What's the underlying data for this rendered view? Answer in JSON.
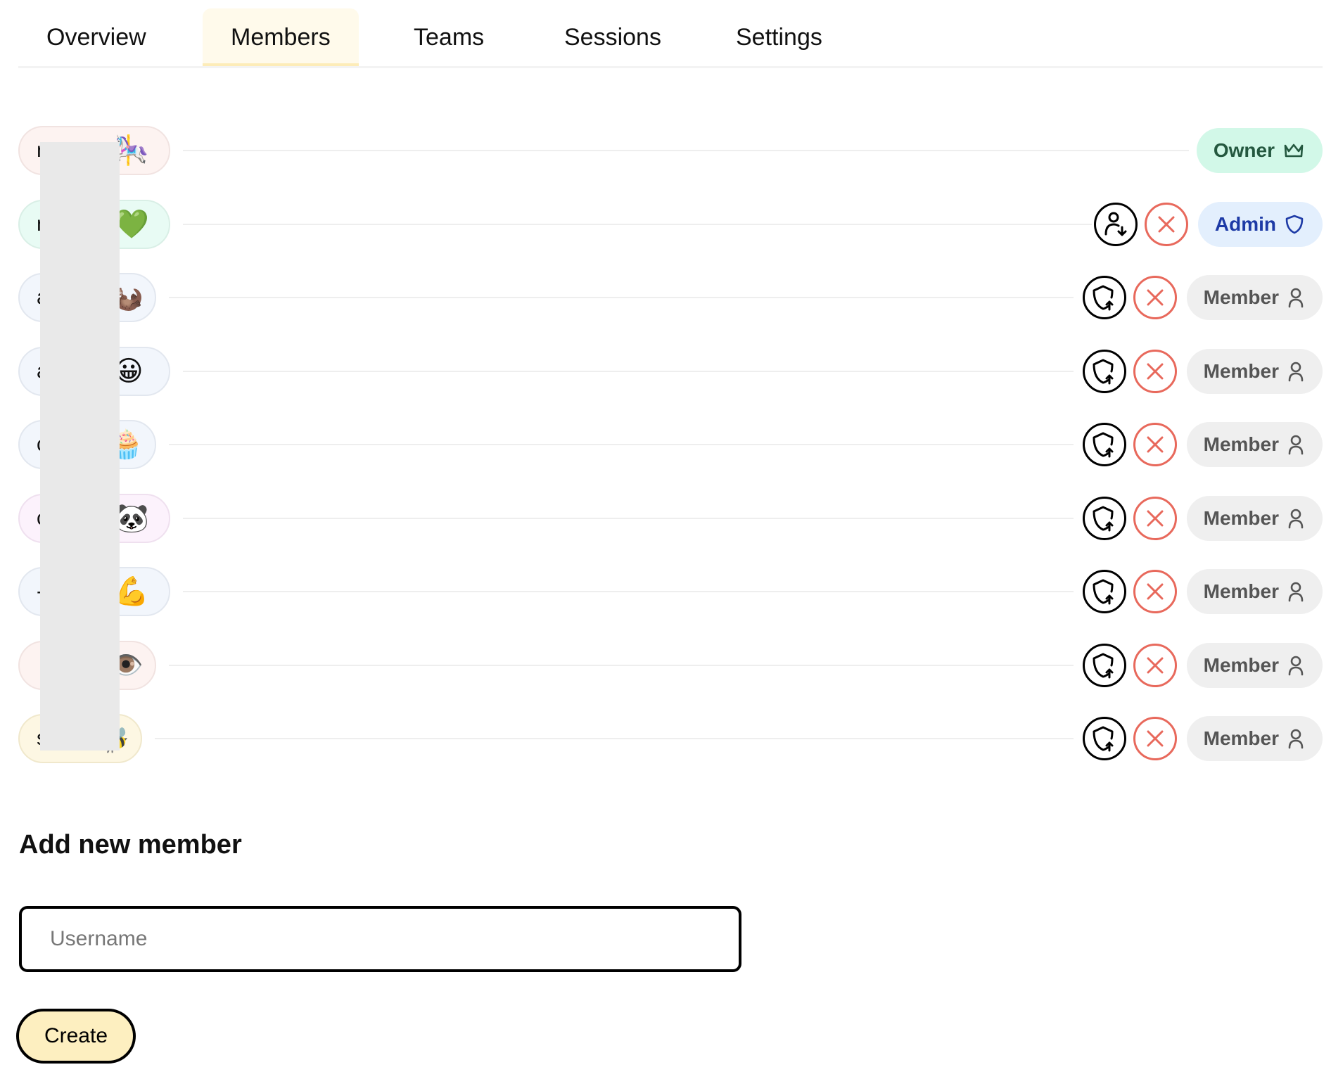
{
  "tabs": [
    {
      "label": "Overview",
      "active": false
    },
    {
      "label": "Members",
      "active": true
    },
    {
      "label": "Teams",
      "active": false
    },
    {
      "label": "Sessions",
      "active": false
    },
    {
      "label": "Settings",
      "active": false
    }
  ],
  "members": [
    {
      "name_initial": "n",
      "emoji": "🎠",
      "emoji_name": "carousel-horse-icon",
      "role": "Owner",
      "role_icon": "crown-icon",
      "pill_bg": "#fdf3f1",
      "pill_border": "#f1e3e1",
      "actions": []
    },
    {
      "name_initial": "n",
      "emoji": "💚",
      "emoji_name": "green-heart-icon",
      "role": "Admin",
      "role_icon": "shield-icon",
      "pill_bg": "#e8fbf4",
      "pill_border": "#d9efe6",
      "actions": [
        "demote",
        "remove"
      ]
    },
    {
      "name_initial": "a",
      "emoji": "🦦",
      "emoji_name": "otter-icon",
      "role": "Member",
      "role_icon": "user-icon",
      "pill_bg": "#f2f6fc",
      "pill_border": "#e2e7ef",
      "actions": [
        "promote",
        "remove"
      ]
    },
    {
      "name_initial": "a",
      "emoji": "😀",
      "emoji_name": "grinning-face-icon",
      "role": "Member",
      "role_icon": "user-icon",
      "pill_bg": "#f2f6fc",
      "pill_border": "#e2e7ef",
      "actions": [
        "promote",
        "remove"
      ]
    },
    {
      "name_initial": "c",
      "emoji": "🧁",
      "emoji_name": "cupcake-icon",
      "role": "Member",
      "role_icon": "user-icon",
      "pill_bg": "#f2f6fc",
      "pill_border": "#e2e7ef",
      "actions": [
        "promote",
        "remove"
      ]
    },
    {
      "name_initial": "c",
      "emoji": "🐼",
      "emoji_name": "panda-icon",
      "role": "Member",
      "role_icon": "user-icon",
      "pill_bg": "#fcf2fc",
      "pill_border": "#efe0ef",
      "actions": [
        "promote",
        "remove"
      ]
    },
    {
      "name_initial": "-",
      "emoji": "💪",
      "emoji_name": "flexed-biceps-icon",
      "role": "Member",
      "role_icon": "user-icon",
      "pill_bg": "#f2f6fc",
      "pill_border": "#e2e7ef",
      "actions": [
        "promote",
        "remove"
      ]
    },
    {
      "name_initial": "",
      "emoji": "👁️",
      "emoji_name": "eye-icon",
      "role": "Member",
      "role_icon": "user-icon",
      "pill_bg": "#fdf3f1",
      "pill_border": "#f1e3e1",
      "actions": [
        "promote",
        "remove"
      ]
    },
    {
      "name_initial": "s",
      "emoji": "🐝",
      "emoji_name": "bee-icon",
      "role": "Member",
      "role_icon": "user-icon",
      "pill_bg": "#fdf7e3",
      "pill_border": "#f0e8cc",
      "actions": [
        "promote",
        "remove"
      ]
    }
  ],
  "add_member": {
    "title": "Add new member",
    "username_placeholder": "Username",
    "username_value": "",
    "create_label": "Create"
  },
  "colors": {
    "remove_red": "#e8695c",
    "owner_badge_bg": "#d2f8e8",
    "admin_badge_bg": "#e3effd",
    "member_badge_bg": "#efefef",
    "create_button_bg": "#fdefc0"
  }
}
